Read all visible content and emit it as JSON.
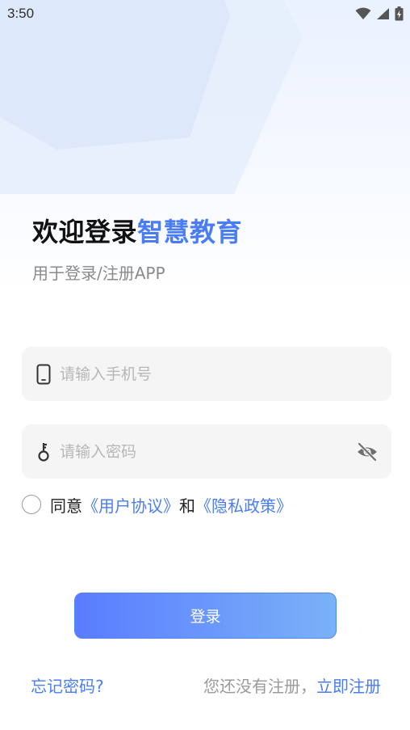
{
  "status_bar": {
    "time": "3:50",
    "icons": [
      "wifi-icon",
      "signal-icon",
      "battery-icon"
    ]
  },
  "header": {
    "title_prefix": "欢迎登录",
    "title_accent": "智慧教育",
    "subtitle": "用于登录/注册APP"
  },
  "form": {
    "phone": {
      "placeholder": "请输入手机号",
      "value": "",
      "icon": "phone-icon"
    },
    "password": {
      "placeholder": "请输入密码",
      "value": "",
      "icon": "key-icon",
      "toggle_icon": "eye-off-icon"
    }
  },
  "agreement": {
    "checked": false,
    "prefix": "同意",
    "user_agreement": "《用户协议》",
    "connector": "和",
    "privacy_policy": "《隐私政策》"
  },
  "login_button": {
    "label": "登录"
  },
  "footer": {
    "forgot_password": "忘记密码?",
    "no_account_hint": "您还没有注册，",
    "register_now": "立即注册"
  },
  "colors": {
    "accent": "#4a7df5",
    "button_start": "#5a7cff",
    "button_end": "#7ab2f7",
    "field_bg": "#f5f5f5"
  }
}
